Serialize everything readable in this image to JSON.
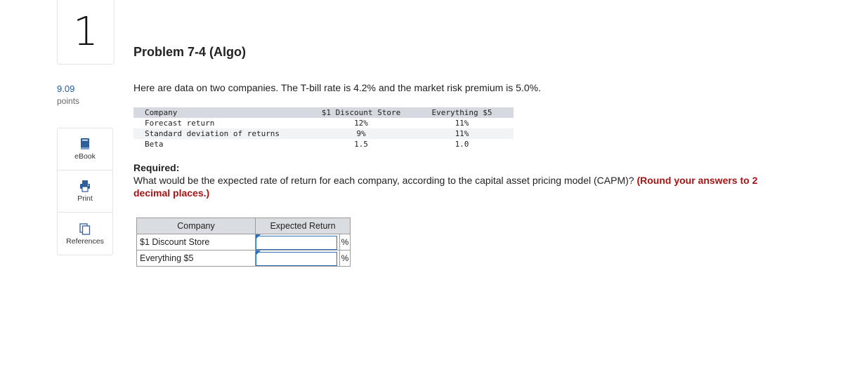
{
  "question_number": "1",
  "points": {
    "value": "9.09",
    "label": "points"
  },
  "tools": [
    {
      "label": "eBook",
      "icon": "book-icon"
    },
    {
      "label": "Print",
      "icon": "printer-icon"
    },
    {
      "label": "References",
      "icon": "references-icon"
    }
  ],
  "problem": {
    "title": "Problem 7-4 (Algo)",
    "intro": "Here are data on two companies. The T-bill rate is 4.2% and the market risk premium is 5.0%.",
    "data_table": {
      "headers": [
        "Company",
        "$1 Discount Store",
        "Everything $5"
      ],
      "rows": [
        [
          "Forecast return",
          "12%",
          "11%"
        ],
        [
          "Standard deviation of returns",
          "9%",
          "11%"
        ],
        [
          "Beta",
          "1.5",
          "1.0"
        ]
      ]
    },
    "required_title": "Required:",
    "question_text": "What would be the expected rate of return for each company, according to the capital asset pricing model (CAPM)? ",
    "question_emphasis": "(Round your answers to 2 decimal places.)"
  },
  "answer_table": {
    "headers": [
      "Company",
      "Expected Return"
    ],
    "rows": [
      {
        "company": "$1 Discount Store",
        "value": "",
        "unit": "%"
      },
      {
        "company": "Everything $5",
        "value": "",
        "unit": "%"
      }
    ]
  },
  "colors": {
    "link_blue": "#1f5a96",
    "emphasis_red": "#a31515",
    "input_border": "#2f6db5",
    "header_gray": "#d6dae0"
  }
}
